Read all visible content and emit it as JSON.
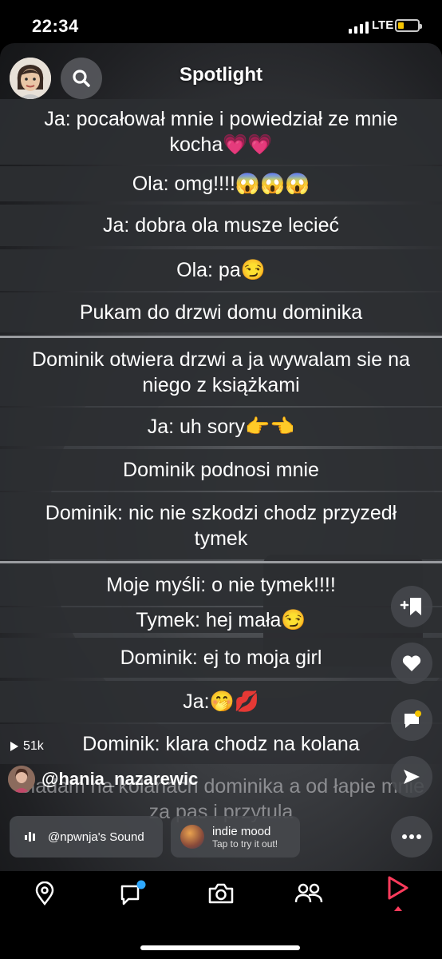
{
  "status_bar": {
    "time": "22:34",
    "network": "LTE",
    "battery_color": "#f5c400"
  },
  "header": {
    "title": "Spotlight"
  },
  "story_lines": [
    "Ja: pocałował mnie i powiedział ze mnie kocha💗💗",
    "Ola: omg!!!!😱😱😱",
    "Ja: dobra ola musze lecieć",
    "Ola: pa😏",
    "Pukam do drzwi domu dominika",
    "Dominik otwiera drzwi a ja wywalam sie na niego z książkami",
    "Ja: uh sory👉👈",
    "Dominik podnosi mnie",
    "Dominik: nic nie szkodzi chodz przyzedł tymek",
    "Moje myśli: o nie tymek!!!!",
    "Tymek: hej mała😏",
    "Dominik: ej to moja girl",
    "Ja:🤭💋",
    "Dominik: klara chodz na kolana"
  ],
  "overlay_caption": "Siadam na kolanach dominika a od łapie mnie za pas i przytula",
  "post": {
    "views": "51k",
    "username": "@hania_nazarewic"
  },
  "sound": {
    "label": "@npwnja's Sound"
  },
  "lens": {
    "name": "indie mood",
    "cta": "Tap to try it out!"
  },
  "actions": [
    "bookmark-add-icon",
    "heart-icon",
    "comment-icon",
    "share-icon",
    "more-icon"
  ],
  "nav": [
    "map-icon",
    "chat-icon",
    "camera-icon",
    "friends-icon",
    "spotlight-icon"
  ],
  "colors": {
    "accent": "#ff3b5c",
    "notification": "#2ea8ff"
  }
}
